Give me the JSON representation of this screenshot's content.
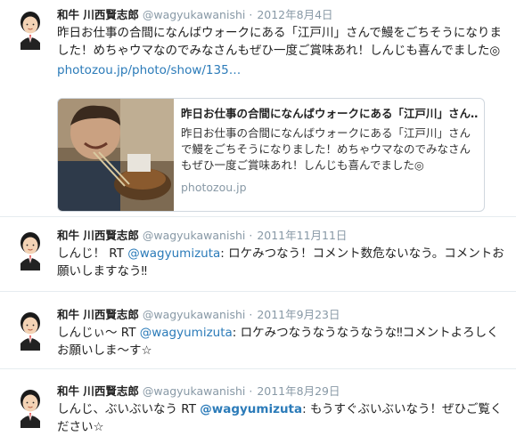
{
  "tweets": [
    {
      "name": "和牛 川西賢志郎",
      "handle": "@wagyukawanishi",
      "dot": "·",
      "date": "2012年8月4日",
      "text": "昨日お仕事の合間になんばウォークにある「江戸川」さんで鰻をごちそうになりました！めちゃウマなのでみなさんもぜひ一度ご賞味あれ！しんじも喜んでました◎",
      "link": "photozou.jp/photo/show/135…",
      "card": {
        "title": "昨日お仕事の合間になんばウォークにある「江戸川」さん…",
        "description": "昨日お仕事の合間になんばウォークにある「江戸川」さんで鰻をごちそうになりました！めちゃウマなのでみなさんもぜひ一度ご賞味あれ！しんじも喜んでました◎",
        "domain": "photozou.jp"
      }
    },
    {
      "name": "和牛 川西賢志郎",
      "handle": "@wagyukawanishi",
      "dot": "·",
      "date": "2011年11月11日",
      "text_prefix": "しんじ！ RT ",
      "mention": "@wagyumizuta",
      "text_suffix": ": ロケみつなう！コメント数危ないなう。コメントお願いしますなう‼"
    },
    {
      "name": "和牛 川西賢志郎",
      "handle": "@wagyukawanishi",
      "dot": "·",
      "date": "2011年9月23日",
      "text_prefix": "しんじぃ～ RT ",
      "mention": "@wagyumizuta",
      "text_suffix": ": ロケみつなうなうなうなうな‼コメントよろしくお願いしま～す☆"
    },
    {
      "name": "和牛 川西賢志郎",
      "handle": "@wagyukawanishi",
      "dot": "·",
      "date": "2011年8月29日",
      "text_prefix": "しんじ、ぶいぶいなう RT ",
      "mention": "@wagyumizuta",
      "text_suffix": ": もうすぐぶいぶいなう！ぜひご覧ください☆"
    }
  ]
}
